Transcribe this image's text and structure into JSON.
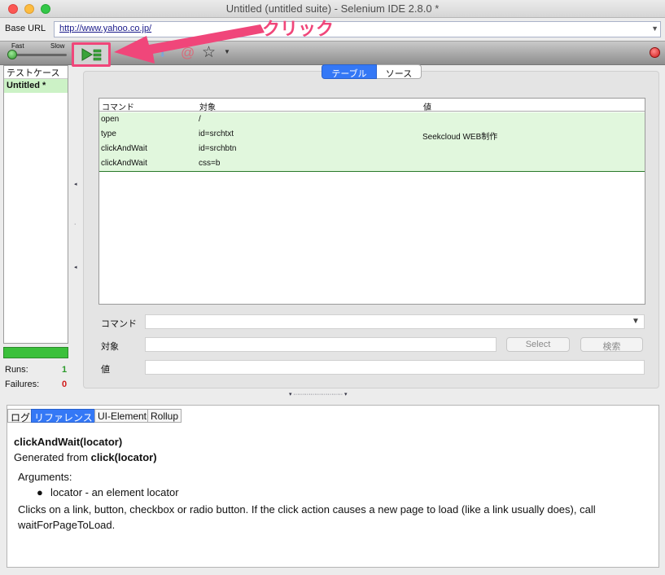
{
  "window": {
    "title": "Untitled (untitled suite) - Selenium IDE 2.8.0 *"
  },
  "base_url": {
    "label": "Base URL",
    "value": "http://www.yahoo.co.jp/"
  },
  "toolbar": {
    "speed_fast": "Fast",
    "speed_slow": "Slow"
  },
  "annotation": {
    "text": "クリック",
    "color": "#f0467a"
  },
  "testcases": {
    "header": "テストケース",
    "items": [
      {
        "label": "Untitled *"
      }
    ]
  },
  "stats": {
    "runs_label": "Runs:",
    "runs": "1",
    "failures_label": "Failures:",
    "failures": "0"
  },
  "editor": {
    "tabs": [
      {
        "label": "テーブル",
        "active": true
      },
      {
        "label": "ソース",
        "active": false
      }
    ],
    "columns": [
      "コマンド",
      "対象",
      "値"
    ],
    "rows": [
      {
        "command": "open",
        "target": "/",
        "value": ""
      },
      {
        "command": "type",
        "target": "id=srchtxt",
        "value": "Seekcloud WEB制作"
      },
      {
        "command": "clickAndWait",
        "target": "id=srchbtn",
        "value": ""
      },
      {
        "command": "clickAndWait",
        "target": "css=b",
        "value": ""
      }
    ],
    "form": {
      "command_label": "コマンド",
      "target_label": "対象",
      "value_label": "値",
      "select_button": "Select",
      "find_button": "検索"
    }
  },
  "bottom": {
    "tabs": [
      {
        "label": "ログ"
      },
      {
        "label": "リファレンス"
      },
      {
        "label": "UI-Element"
      },
      {
        "label": "Rollup"
      }
    ],
    "reference": {
      "title": "clickAndWait(locator)",
      "generated_prefix": "Generated from ",
      "generated_from": "click(locator)",
      "arguments_label": "Arguments:",
      "arg_bullet": "●",
      "argument": "locator - an element locator",
      "description": "Clicks on a link, button, checkbox or radio button. If the click action causes a new page to load (like a link usually does), call waitForPageToLoad."
    }
  },
  "colors": {
    "accent": "#3478f6",
    "row_green": "#e1f7dd",
    "highlight": "#f0467a"
  }
}
